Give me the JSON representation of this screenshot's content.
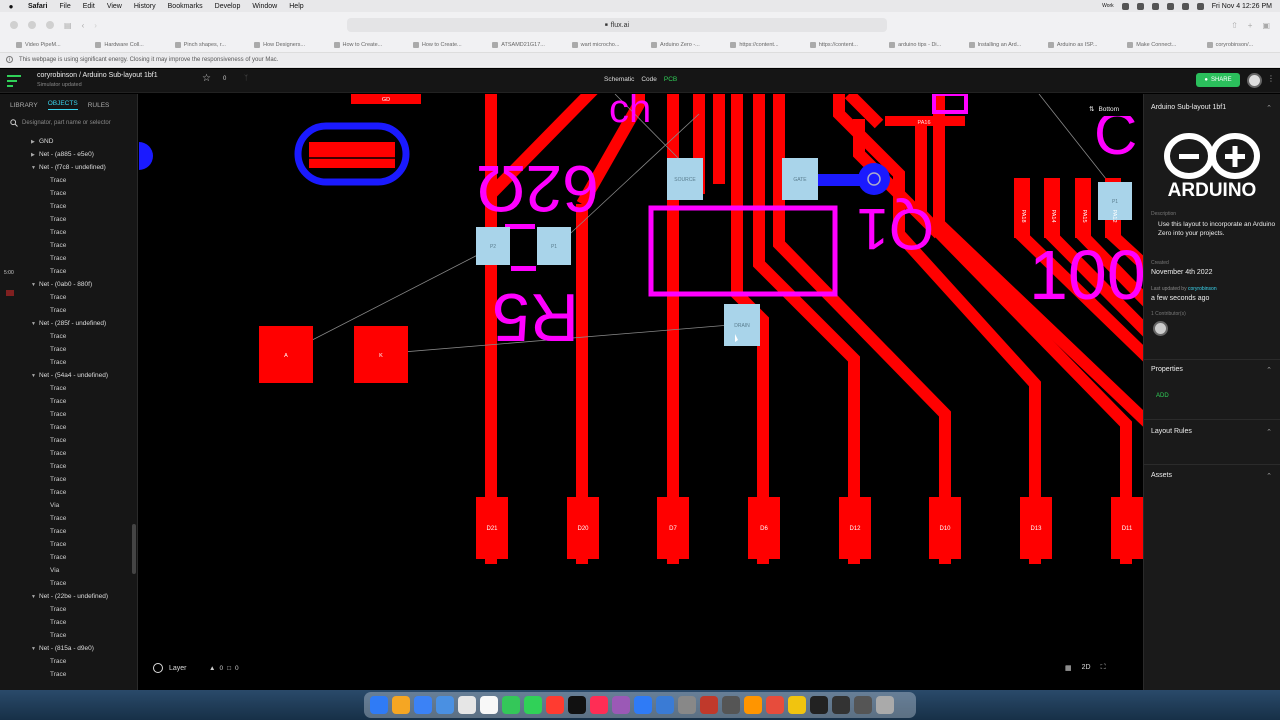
{
  "menubar": {
    "app": "Safari",
    "items": [
      "File",
      "Edit",
      "View",
      "History",
      "Bookmarks",
      "Develop",
      "Window",
      "Help"
    ],
    "clock": "Fri Nov 4  12:26 PM",
    "status": "Work"
  },
  "browser": {
    "url": "flux.ai",
    "tabs": [
      "Video PipeM...",
      "Hardware Coll...",
      "Pinch shapes, r...",
      "How Designers...",
      "How to Create...",
      "How to Create...",
      "ATSAMD21G17...",
      "wart microcho...",
      "Arduino Zero -...",
      "https://content...",
      "https://content...",
      "arduino tips - Di...",
      "Installing an Ard...",
      "Arduino as ISP...",
      "Make Connect...",
      "coryrobinson/..."
    ],
    "energy_notice": "This webpage is using significant energy. Closing it may improve the responsiveness of your Mac."
  },
  "header": {
    "project_title": "coryrobinson / Arduino Sub-layout 1bf1",
    "subtitle": "Simulator updated",
    "star_count": "0",
    "views": [
      "Schematic",
      "Code",
      "PCB"
    ],
    "active_view": "PCB",
    "share_label": "SHARE"
  },
  "left_panel": {
    "tabs": [
      "LIBRARY",
      "OBJECTS",
      "RULES"
    ],
    "active_tab": "OBJECTS",
    "search_placeholder": "Designator, part name or selector",
    "side_time": "5:00",
    "tree": [
      {
        "type": "net",
        "label": "GND",
        "expanded": false
      },
      {
        "type": "net",
        "label": "Net - (a885 - e5e0)",
        "expanded": false
      },
      {
        "type": "net",
        "label": "Net - (f7c8 - undefined)",
        "expanded": true
      },
      {
        "type": "child",
        "label": "Trace"
      },
      {
        "type": "child",
        "label": "Trace"
      },
      {
        "type": "child",
        "label": "Trace"
      },
      {
        "type": "child",
        "label": "Trace"
      },
      {
        "type": "child",
        "label": "Trace"
      },
      {
        "type": "child",
        "label": "Trace"
      },
      {
        "type": "child",
        "label": "Trace"
      },
      {
        "type": "child",
        "label": "Trace"
      },
      {
        "type": "net",
        "label": "Net - (0ab0 - 880f)",
        "expanded": true
      },
      {
        "type": "child",
        "label": "Trace"
      },
      {
        "type": "child",
        "label": "Trace"
      },
      {
        "type": "net",
        "label": "Net - (285f - undefined)",
        "expanded": true
      },
      {
        "type": "child",
        "label": "Trace"
      },
      {
        "type": "child",
        "label": "Trace"
      },
      {
        "type": "child",
        "label": "Trace"
      },
      {
        "type": "net",
        "label": "Net - (54a4 - undefined)",
        "expanded": true
      },
      {
        "type": "child",
        "label": "Trace"
      },
      {
        "type": "child",
        "label": "Trace"
      },
      {
        "type": "child",
        "label": "Trace"
      },
      {
        "type": "child",
        "label": "Trace"
      },
      {
        "type": "child",
        "label": "Trace"
      },
      {
        "type": "child",
        "label": "Trace"
      },
      {
        "type": "child",
        "label": "Trace"
      },
      {
        "type": "child",
        "label": "Trace"
      },
      {
        "type": "child",
        "label": "Trace"
      },
      {
        "type": "child",
        "label": "Via"
      },
      {
        "type": "child",
        "label": "Trace"
      },
      {
        "type": "child",
        "label": "Trace"
      },
      {
        "type": "child",
        "label": "Trace"
      },
      {
        "type": "child",
        "label": "Trace"
      },
      {
        "type": "child",
        "label": "Via"
      },
      {
        "type": "child",
        "label": "Trace"
      },
      {
        "type": "net",
        "label": "Net - (22be - undefined)",
        "expanded": true
      },
      {
        "type": "child",
        "label": "Trace"
      },
      {
        "type": "child",
        "label": "Trace"
      },
      {
        "type": "child",
        "label": "Trace"
      },
      {
        "type": "net",
        "label": "Net - (815a - d9e0)",
        "expanded": true
      },
      {
        "type": "child",
        "label": "Trace"
      },
      {
        "type": "child",
        "label": "Trace"
      }
    ]
  },
  "canvas": {
    "layer_toggle": "Bottom",
    "layer_button": "Layer",
    "warning_count": "0",
    "error_count": "0",
    "view_mode": "2D",
    "silkscreen": {
      "r5": "R5",
      "val_620": "62Ω",
      "q1": "Q1",
      "val_100": "100",
      "c": "C",
      "partial": "ch"
    },
    "pads": {
      "source": "SOURCE",
      "gate": "GATE",
      "drain": "DRAIN",
      "r5_p2": "P2",
      "r5_p1": "P1",
      "pad_a": "A",
      "pad_k": "K",
      "pa16": "PA16",
      "pa18": "PA18",
      "pa14": "PA14",
      "pa15": "PA15",
      "pa12": "PA12",
      "top_label": "GD",
      "p1_right": "P1"
    },
    "headers": [
      "D21",
      "D20",
      "D7",
      "D6",
      "D12",
      "D10",
      "D13",
      "D11"
    ],
    "colors": {
      "copper": "#ff0000",
      "silk": "#ff00ff",
      "pad": "#a9d4ea",
      "blue": "#1a1aff"
    }
  },
  "right_panel": {
    "title": "Arduino Sub-layout 1bf1",
    "logo_text": "ARDUINO",
    "description_label": "Description",
    "description": "Use this layout to incorporate an Arduino Zero into your projects.",
    "created_label": "Created",
    "created": "November 4th 2022",
    "updated_label": "Last updated by",
    "updated_by": "coryrobinson",
    "updated": "a few seconds ago",
    "contributors_label": "1 Contributor(s)",
    "properties_label": "Properties",
    "add_label": "ADD",
    "layout_rules_label": "Layout Rules",
    "assets_label": "Assets"
  }
}
